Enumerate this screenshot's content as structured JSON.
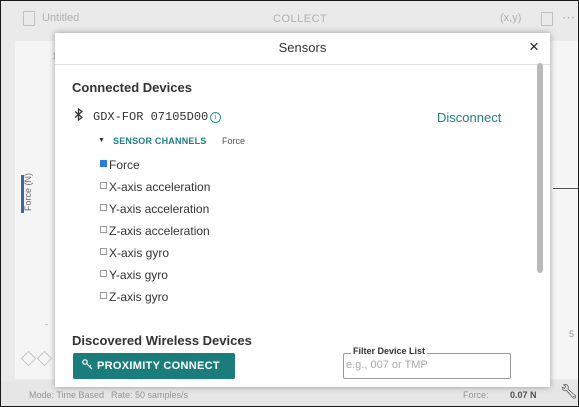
{
  "background": {
    "doc_title": "Untitled",
    "mode_title": "COLLECT",
    "xy_label": "(x,y)",
    "y_axis_label": "Force (N)",
    "status": {
      "mode": "Mode: Time Based",
      "rate": "Rate: 50 samples/s",
      "force_label": "Force:",
      "force_value": "0.07 N"
    }
  },
  "modal": {
    "title": "Sensors",
    "close_glyph": "×",
    "connected_heading": "Connected Devices",
    "device": {
      "name": "GDX-FOR 07105D00",
      "disconnect_label": "Disconnect",
      "sensor_channels_label": "SENSOR CHANNELS",
      "sensor_channels_summary": "Force",
      "channels": [
        {
          "label": "Force",
          "checked": true
        },
        {
          "label": "X-axis acceleration",
          "checked": false
        },
        {
          "label": "Y-axis acceleration",
          "checked": false
        },
        {
          "label": "Z-axis acceleration",
          "checked": false
        },
        {
          "label": "X-axis gyro",
          "checked": false
        },
        {
          "label": "Y-axis gyro",
          "checked": false
        },
        {
          "label": "Z-axis gyro",
          "checked": false
        }
      ]
    },
    "discovered_heading": "Discovered Wireless Devices",
    "proximity_label": "PROXIMITY CONNECT",
    "filter": {
      "legend": "Filter Device List",
      "placeholder": "e.g., 007 or TMP"
    }
  },
  "icons": {
    "bluetooth": "bluetooth-icon",
    "info": "info-icon",
    "close": "close-icon",
    "key": "key-icon",
    "caret": "caret-down-icon",
    "wrench": "wrench-icon"
  },
  "colors": {
    "accent_teal": "#1a7d7c",
    "link_teal": "#1f7d86",
    "checkbox_blue": "#2a7fd4"
  }
}
